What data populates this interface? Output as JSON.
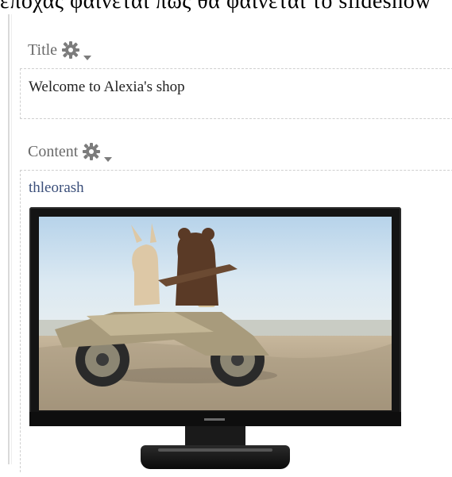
{
  "page": {
    "top_caption": "εποχας φαίνεται πώς θα φαίνεται το slideshow"
  },
  "title_field": {
    "label": "Title",
    "value": "Welcome to Alexia's shop"
  },
  "content_field": {
    "label": "Content",
    "link_text": "thleorash"
  },
  "image": {
    "subject": "tv-image"
  },
  "colors": {
    "label_gray": "#6a6a6a",
    "link_blue": "#3b4f7a",
    "dashed_border": "#cfcfcf"
  }
}
